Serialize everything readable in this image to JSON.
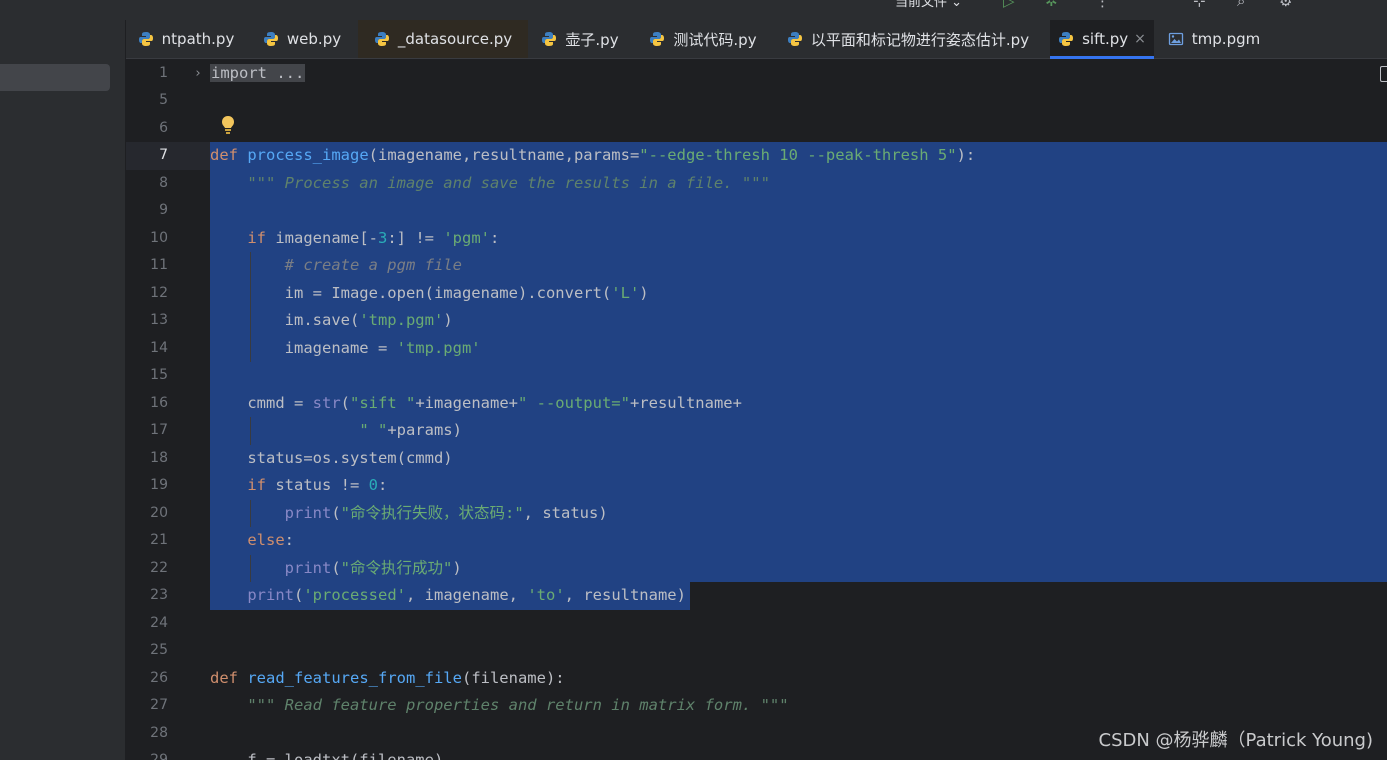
{
  "toolbar": {
    "run_config": "当前文件 ⌄"
  },
  "tabs": [
    {
      "label": "ntpath.py",
      "icon": "python-file-icon"
    },
    {
      "label": "web.py",
      "icon": "python-file-icon"
    },
    {
      "label": "_datasource.py",
      "icon": "python-file-icon"
    },
    {
      "label": "壶子.py",
      "icon": "python-file-icon"
    },
    {
      "label": "测试代码.py",
      "icon": "python-file-icon"
    },
    {
      "label": "以平面和标记物进行姿态估计.py",
      "icon": "python-file-icon"
    },
    {
      "label": "sift.py",
      "icon": "python-file-icon",
      "active": true,
      "close": "×"
    },
    {
      "label": "tmp.pgm",
      "icon": "image-file-icon"
    }
  ],
  "editor": {
    "current_line": "7",
    "lines": [
      {
        "n": "1",
        "code": "import ..."
      },
      {
        "n": "5",
        "code": ""
      },
      {
        "n": "6",
        "code": ""
      },
      {
        "n": "7",
        "code": "def process_image(imagename,resultname,params=\"--edge-thresh 10 --peak-thresh 5\"):"
      },
      {
        "n": "8",
        "code": "    \"\"\" Process an image and save the results in a file. \"\"\""
      },
      {
        "n": "9",
        "code": ""
      },
      {
        "n": "10",
        "code": "    if imagename[-3:] != 'pgm':"
      },
      {
        "n": "11",
        "code": "        # create a pgm file"
      },
      {
        "n": "12",
        "code": "        im = Image.open(imagename).convert('L')"
      },
      {
        "n": "13",
        "code": "        im.save('tmp.pgm')"
      },
      {
        "n": "14",
        "code": "        imagename = 'tmp.pgm'"
      },
      {
        "n": "15",
        "code": ""
      },
      {
        "n": "16",
        "code": "    cmmd = str(\"sift \"+imagename+\" --output=\"+resultname+"
      },
      {
        "n": "17",
        "code": "                \" \"+params)"
      },
      {
        "n": "18",
        "code": "    status=os.system(cmmd)"
      },
      {
        "n": "19",
        "code": "    if status != 0:"
      },
      {
        "n": "20",
        "code": "        print(\"命令执行失败，状态码:\", status)"
      },
      {
        "n": "21",
        "code": "    else:"
      },
      {
        "n": "22",
        "code": "        print(\"命令执行成功\")"
      },
      {
        "n": "23",
        "code": "    print('processed', imagename, 'to', resultname)"
      },
      {
        "n": "24",
        "code": ""
      },
      {
        "n": "25",
        "code": ""
      },
      {
        "n": "26",
        "code": "def read_features_from_file(filename):"
      },
      {
        "n": "27",
        "code": "    \"\"\" Read feature properties and return in matrix form. \"\"\""
      },
      {
        "n": "28",
        "code": ""
      },
      {
        "n": "29",
        "code": "    f = loadtxt(filename)"
      }
    ]
  },
  "watermark": "CSDN @杨骅麟（Patrick Young)",
  "colors": {
    "background": "#1e1f22",
    "panel": "#2b2d30",
    "selection": "#214283",
    "keyword": "#cf8e6d",
    "function": "#56a8f5",
    "string": "#6aab73",
    "number": "#2aacb8",
    "comment": "#7a7e85",
    "accent": "#3574f0"
  }
}
